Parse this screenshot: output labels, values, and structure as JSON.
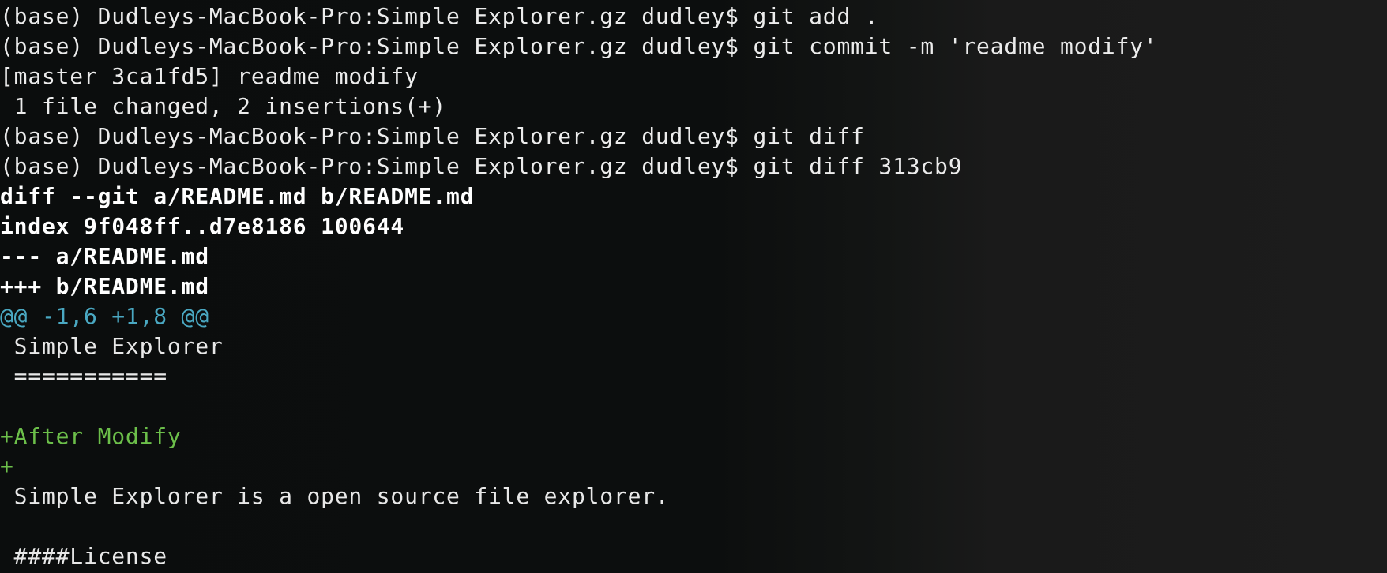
{
  "window": {
    "type": "terminal",
    "background": "#0c0e0e",
    "colors": {
      "text": "#ececec",
      "bold": "#ffffff",
      "hunk": "#4aa8c2",
      "added": "#6cbf4a"
    }
  },
  "terminal": {
    "lines": [
      {
        "kind": "prompt",
        "text": "(base) Dudleys-MacBook-Pro:Simple Explorer.gz dudley$ git add ."
      },
      {
        "kind": "prompt",
        "text": "(base) Dudleys-MacBook-Pro:Simple Explorer.gz dudley$ git commit -m 'readme modify'"
      },
      {
        "kind": "output",
        "text": "[master 3ca1fd5] readme modify"
      },
      {
        "kind": "output",
        "text": " 1 file changed, 2 insertions(+)"
      },
      {
        "kind": "prompt",
        "text": "(base) Dudleys-MacBook-Pro:Simple Explorer.gz dudley$ git diff"
      },
      {
        "kind": "prompt",
        "text": "(base) Dudleys-MacBook-Pro:Simple Explorer.gz dudley$ git diff 313cb9"
      },
      {
        "kind": "diff-header",
        "text": "diff --git a/README.md b/README.md"
      },
      {
        "kind": "diff-header",
        "text": "index 9f048ff..d7e8186 100644"
      },
      {
        "kind": "diff-header",
        "text": "--- a/README.md"
      },
      {
        "kind": "diff-header",
        "text": "+++ b/README.md"
      },
      {
        "kind": "hunk",
        "text": "@@ -1,6 +1,8 @@"
      },
      {
        "kind": "context",
        "text": " Simple Explorer"
      },
      {
        "kind": "context",
        "text": " ==========="
      },
      {
        "kind": "context",
        "text": " "
      },
      {
        "kind": "added",
        "text": "+After Modify"
      },
      {
        "kind": "added",
        "text": "+"
      },
      {
        "kind": "context",
        "text": " Simple Explorer is a open source file explorer."
      },
      {
        "kind": "context",
        "text": " "
      },
      {
        "kind": "context",
        "text": " ####License"
      }
    ]
  }
}
